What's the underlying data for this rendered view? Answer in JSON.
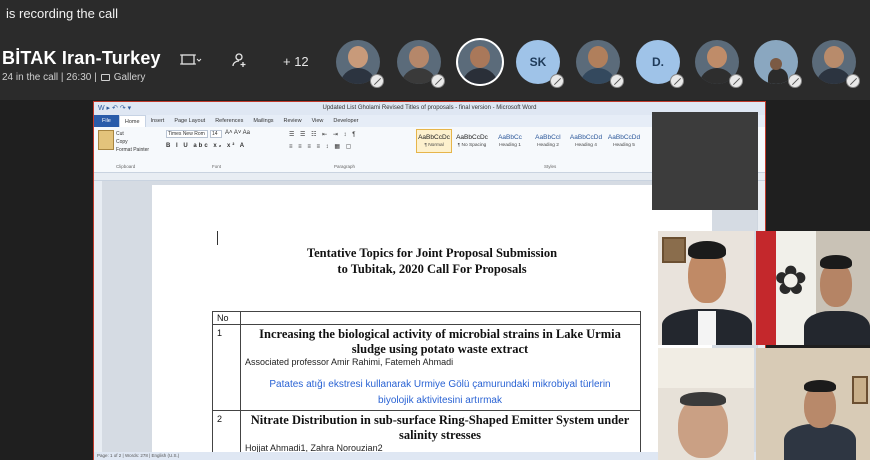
{
  "banner": {
    "text": "is recording the call"
  },
  "meeting": {
    "title": "BİTAK Iran-Turkey",
    "meta": "24 in the call | 26:30 |",
    "gallery_label": "Gallery",
    "more_count": "+ 12"
  },
  "participants": [
    {
      "kind": "photo",
      "name": "participant-1"
    },
    {
      "kind": "photo",
      "name": "participant-2"
    },
    {
      "kind": "photo",
      "name": "participant-3"
    },
    {
      "kind": "initials",
      "initials": "SK"
    },
    {
      "kind": "photo",
      "name": "participant-5"
    },
    {
      "kind": "initials",
      "initials": "D."
    },
    {
      "kind": "photo",
      "name": "participant-7"
    },
    {
      "kind": "photo",
      "name": "participant-8"
    },
    {
      "kind": "photo",
      "name": "participant-9"
    }
  ],
  "word": {
    "window_title": "Updated List Gholami Revised Titles of proposals - final version - Microsoft Word",
    "tabs": [
      "File",
      "Home",
      "Insert",
      "Page Layout",
      "References",
      "Mailings",
      "Review",
      "View",
      "Developer"
    ],
    "clipboard": {
      "cut": "Cut",
      "copy": "Copy",
      "format_painter": "Format Painter",
      "paste": "Paste"
    },
    "font_name": "Times New Rom",
    "font_size": "14",
    "group_labels": {
      "clipboard": "Clipboard",
      "font": "Font",
      "paragraph": "Paragraph",
      "styles": "Styles"
    },
    "styles": [
      {
        "preview": "AaBbCcDc",
        "label": "¶ Normal"
      },
      {
        "preview": "AaBbCcDc",
        "label": "¶ No Spacing"
      },
      {
        "preview": "AaBbCc",
        "label": "Heading 1"
      },
      {
        "preview": "AaBbCcI",
        "label": "Heading 2"
      },
      {
        "preview": "AaBbCcDd",
        "label": "Heading 4"
      },
      {
        "preview": "AaBbCcDd",
        "label": "Heading 5"
      }
    ],
    "status": "Page: 1 of 2 | Words: 278 | English (U.S.)"
  },
  "document": {
    "title_line1": "Tentative Topics for Joint Proposal Submission",
    "title_line2": "to Tubitak, 2020 Call For Proposals",
    "table_header": "No",
    "rows": [
      {
        "number": "1",
        "title_line1": "Increasing the biological activity of microbial strains in Lake Urmia",
        "title_line2": "sludge using potato waste extract",
        "authors": "Associated professor Amir Rahimi, Fatemeh Ahmadi",
        "turkish_line1": "Patates atığı ekstresi kullanarak Urmiye Gölü çamurundaki mikrobiyal türlerin",
        "turkish_line2": "biyolojik aktivitesini artırmak"
      },
      {
        "number": "2",
        "title_line1": "Nitrate Distribution in sub-surface Ring-Shaped Emitter System under",
        "title_line2": "salinity stresses",
        "authors": "Hojjat Ahmadi1, Zahra Norouzian2"
      }
    ]
  }
}
